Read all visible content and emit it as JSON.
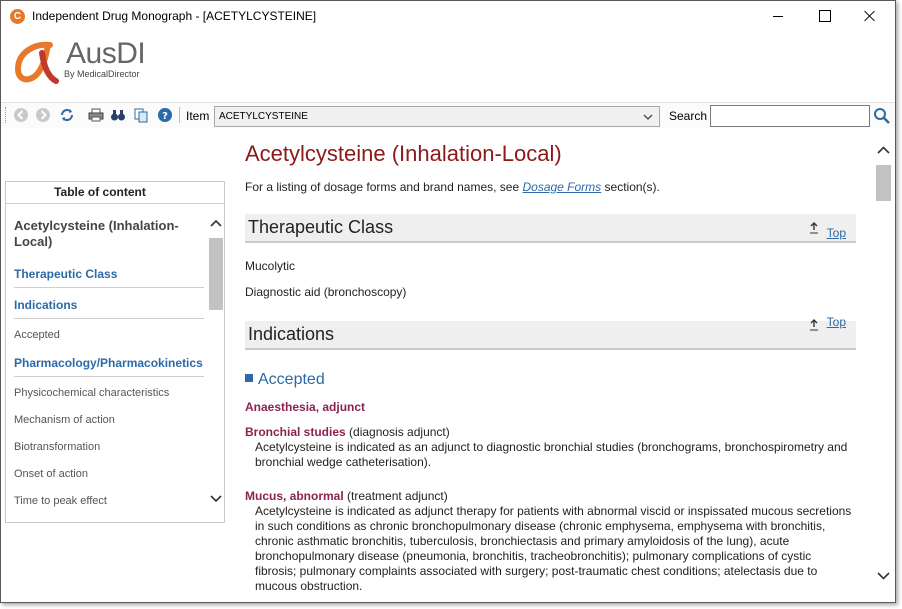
{
  "window": {
    "title": "Independent Drug Monograph - [ACETYLCYSTEINE]"
  },
  "logo": {
    "name": "AusDI",
    "sub": "By MedicalDirector"
  },
  "toolbar": {
    "item_label": "Item",
    "item_value": "ACETYLCYSTEINE",
    "search_label": "Search",
    "search_value": ""
  },
  "toc": {
    "header": "Table of content",
    "title": "Acetylcysteine (Inhalation-Local)",
    "items": [
      {
        "label": "Therapeutic Class"
      },
      {
        "label": "Indications"
      },
      {
        "label": "Accepted"
      },
      {
        "label": "Pharmacology/Pharmacokinetics"
      },
      {
        "label": "Physicochemical characteristics"
      },
      {
        "label": "Mechanism of action"
      },
      {
        "label": "Biotransformation"
      },
      {
        "label": "Onset of action"
      },
      {
        "label": "Time to peak effect"
      }
    ]
  },
  "content": {
    "title": "Acetylcysteine (Inhalation-Local)",
    "intro_prefix": "For a listing of dosage forms and brand names, see ",
    "intro_link": "Dosage Forms",
    "intro_suffix": " section(s).",
    "top_label": "Top",
    "therapeutic_class": {
      "heading": "Therapeutic Class",
      "items": [
        "Mucolytic",
        "Diagnostic aid (bronchoscopy)"
      ]
    },
    "indications": {
      "heading": "Indications",
      "accepted_heading": "Accepted",
      "term1": "Anaesthesia, adjunct",
      "term2_name": "Bronchial studies",
      "term2_qual": " (diagnosis adjunct)",
      "term2_desc": "Acetylcysteine is indicated as an adjunct to diagnostic bronchial studies (bronchograms, bronchospirometry and bronchial wedge catheterisation).",
      "term3_name": "Mucus, abnormal",
      "term3_qual": " (treatment adjunct)",
      "term3_desc": "Acetylcysteine is indicated as adjunct therapy for patients with abnormal viscid or inspissated mucous secretions in such conditions as chronic bronchopulmonary disease (chronic emphysema, emphysema with bronchitis, chronic asthmatic bronchitis, tuberculosis, bronchiectasis and primary amyloidosis of the lung), acute bronchopulmonary disease (pneumonia, bronchitis, tracheobronchitis); pulmonary complications of cystic fibrosis; pulmonary complaints associated with surgery; post-traumatic chest conditions; atelectasis due to mucous obstruction."
    }
  },
  "colors": {
    "title_red": "#8b1a1a",
    "link_blue": "#2b6aa6",
    "term_purple": "#8b2252"
  }
}
